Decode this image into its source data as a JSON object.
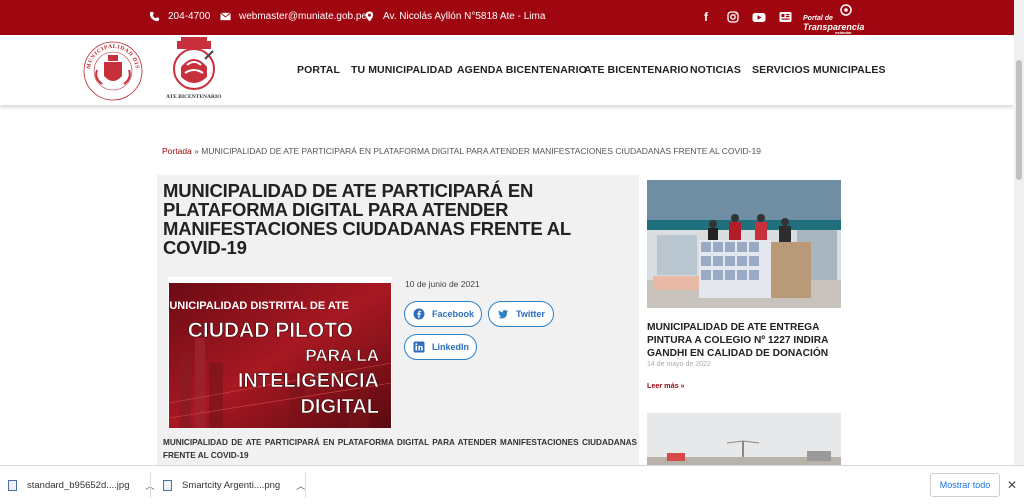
{
  "topbar": {
    "phone": "204-4700",
    "email": "webmaster@muniate.gob.pe",
    "address": "Av. Nicolás Ayllón N°5818 Ate - Lima",
    "social_icons": [
      "facebook-icon",
      "instagram-icon",
      "youtube-icon",
      "flickr-icon"
    ],
    "transparency": {
      "line1": "Portal de",
      "line2": "Transparencia",
      "line3": "estándar"
    },
    "color": "#a0060f"
  },
  "header": {
    "logo_caption": "ATE BICENTENARIO",
    "seal_text": "MUNICIPALIDAD DISTRITAL DE ATE",
    "nav": [
      "PORTAL",
      "TU MUNICIPALIDAD",
      "AGENDA BICENTENARIO",
      "ATE BICENTENARIO",
      "NOTICIAS",
      "SERVICIOS MUNICIPALES"
    ]
  },
  "breadcrumb": {
    "home": "Portada",
    "separator": "»",
    "current": "MUNICIPALIDAD DE ATE PARTICIPARÁ EN PLATAFORMA DIGITAL PARA ATENDER MANIFESTACIONES CIUDADANAS FRENTE AL COVID-19"
  },
  "article": {
    "title": "MUNICIPALIDAD DE ATE PARTICIPARÁ EN PLATAFORMA DIGITAL PARA ATENDER MANIFESTACIONES CIUDADANAS FRENTE AL COVID-19",
    "date": "10 de junio de 2021",
    "image_text": {
      "line1": "MUNICIPALIDAD DISTRITAL DE ATE",
      "line2": "CIUDAD PILOTO",
      "line3": "PARA LA",
      "line4": "INTELIGENCIA",
      "line5": "DIGITAL"
    },
    "share": {
      "facebook": "Facebook",
      "twitter": "Twitter",
      "linkedin": "LinkedIn"
    },
    "summary": "MUNICIPALIDAD DE ATE PARTICIPARÁ EN PLATAFORMA DIGITAL PARA ATENDER MANIFESTACIONES CIUDADANAS FRENTE AL COVID-19"
  },
  "sidebar": {
    "post": {
      "title": "MUNICIPALIDAD DE ATE ENTREGA PINTURA A COLEGIO Nº 1227 INDIRA GANDHI EN CALIDAD DE DONACIÓN",
      "date": "14 de mayo de 2022",
      "more": "Leer más »"
    }
  },
  "downloads": {
    "items": [
      {
        "name": "standard_b95652d....jpg"
      },
      {
        "name": "Smartcity Argenti....png"
      }
    ],
    "show_all": "Mostrar todo",
    "close": "✕"
  }
}
